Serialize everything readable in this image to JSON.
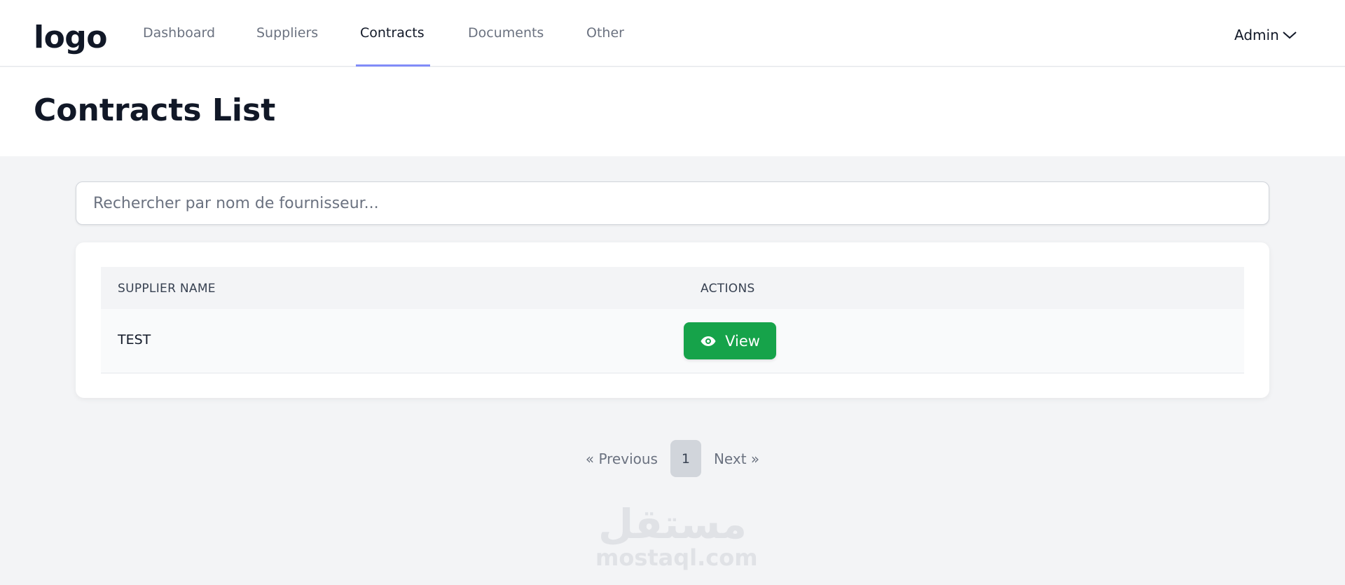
{
  "app": {
    "logo": "logo"
  },
  "nav": {
    "items": [
      {
        "label": "Dashboard"
      },
      {
        "label": "Suppliers"
      },
      {
        "label": "Contracts"
      },
      {
        "label": "Documents"
      },
      {
        "label": "Other"
      }
    ],
    "active": "Contracts",
    "user_label": "Admin",
    "user_icon": "chevron-down-icon",
    "accent_color": "#818cf8"
  },
  "page": {
    "title": "Contracts List"
  },
  "search": {
    "placeholder": "Rechercher par nom de fournisseur...",
    "value": ""
  },
  "table": {
    "headers": [
      "SUPPLIER NAME",
      "ACTIONS"
    ],
    "rows": [
      {
        "supplier_name": "TEST",
        "action_label": "View",
        "action_icon": "eye-icon"
      }
    ],
    "action_color": "#16a34a"
  },
  "pagination": {
    "previous_label": "« Previous",
    "current_page": "1",
    "next_label": "Next »"
  },
  "watermark": {
    "arabic": "مستقل",
    "latin": "mostaql.com"
  }
}
